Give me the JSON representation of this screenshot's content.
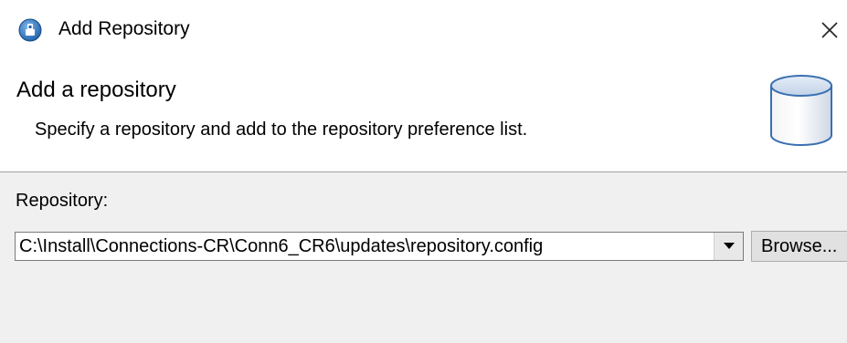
{
  "window": {
    "title": "Add Repository",
    "icon": "repository-app-icon",
    "close_icon": "close-icon"
  },
  "header": {
    "title": "Add a repository",
    "description": "Specify a repository and add to the repository preference list.",
    "image_icon": "database-cylinder-icon"
  },
  "form": {
    "repository_label": "Repository:",
    "repository_value": "C:\\Install\\Connections-CR\\Conn6_CR6\\updates\\repository.config",
    "dropdown_icon": "chevron-down-icon",
    "browse_label": "Browse..."
  },
  "colors": {
    "window_background": "#ffffff",
    "body_background": "#f0f0f0",
    "divider": "#a0a0a0",
    "button_background": "#e1e1e1"
  }
}
